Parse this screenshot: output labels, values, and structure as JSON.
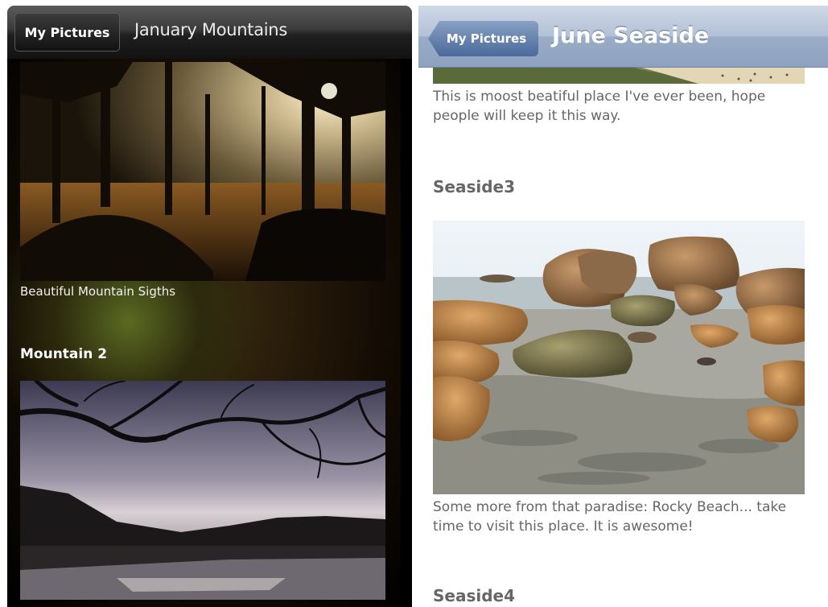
{
  "left_app": {
    "back_button_label": "My Pictures",
    "title": "January Mountains",
    "items": [
      {
        "caption": "Beautiful Mountain Sigths"
      },
      {
        "heading": "Mountain 2"
      }
    ]
  },
  "right_app": {
    "back_button_label": "My Pictures",
    "title": "June Seaside",
    "items": [
      {
        "caption": "This is moost beatiful place I've ever been, hope people will keep it this way."
      },
      {
        "heading": "Seaside3",
        "caption": "Some more from that paradise: Rocky Beach... take time to visit this place. It is awesome!"
      },
      {
        "heading": "Seaside4"
      }
    ]
  },
  "colors": {
    "left_header_bg": "#1e1e1e",
    "right_header_bg": "#a6b7cf",
    "right_back_button": "#5a78a6",
    "right_text": "#666666"
  }
}
